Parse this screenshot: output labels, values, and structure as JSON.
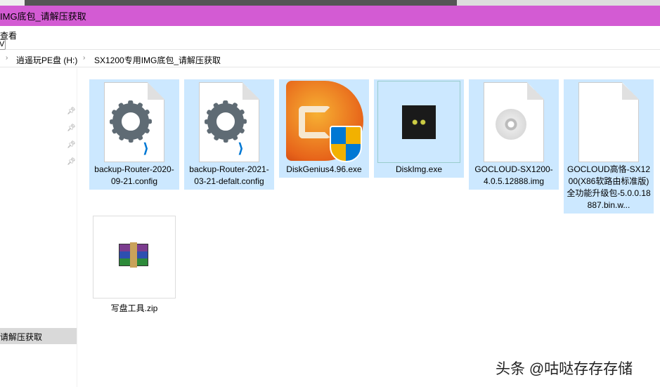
{
  "window": {
    "title": "IMG底包_请解压获取"
  },
  "ribbon": {
    "view_label": "查看",
    "expand_label": "V"
  },
  "address": {
    "crumbs": [
      "逍遥玩PE盘 (H:)",
      "SX1200专用IMG底包_请解压获取"
    ]
  },
  "nav": {
    "selected_label": "请解压获取"
  },
  "files": [
    {
      "name": "backup-Router-2020-09-21.config",
      "icon": "vscode-config-icon",
      "selected": true
    },
    {
      "name": "backup-Router-2021-03-21-defalt.config",
      "icon": "vscode-config-icon",
      "selected": true
    },
    {
      "name": "DiskGenius4.96.exe",
      "icon": "diskgenius-icon",
      "selected": true
    },
    {
      "name": "DiskImg.exe",
      "icon": "cat-thumbnail-icon",
      "selected": true
    },
    {
      "name": "GOCLOUD-SX1200-4.0.5.12888.img",
      "icon": "disc-image-icon",
      "selected": true
    },
    {
      "name": "GOCLOUD高恪-SX1200(X86软路由标准版)全功能升级包-5.0.0.18887.bin.w...",
      "icon": "blank-file-icon",
      "selected": true
    },
    {
      "name": "写盘工具.zip",
      "icon": "winrar-archive-icon",
      "selected": false
    }
  ],
  "watermark": "头条 @咕哒存存存储",
  "colors": {
    "title_bar": "#d35bd3",
    "selection": "#cce8ff",
    "nav_selected": "#d9d9d9"
  }
}
